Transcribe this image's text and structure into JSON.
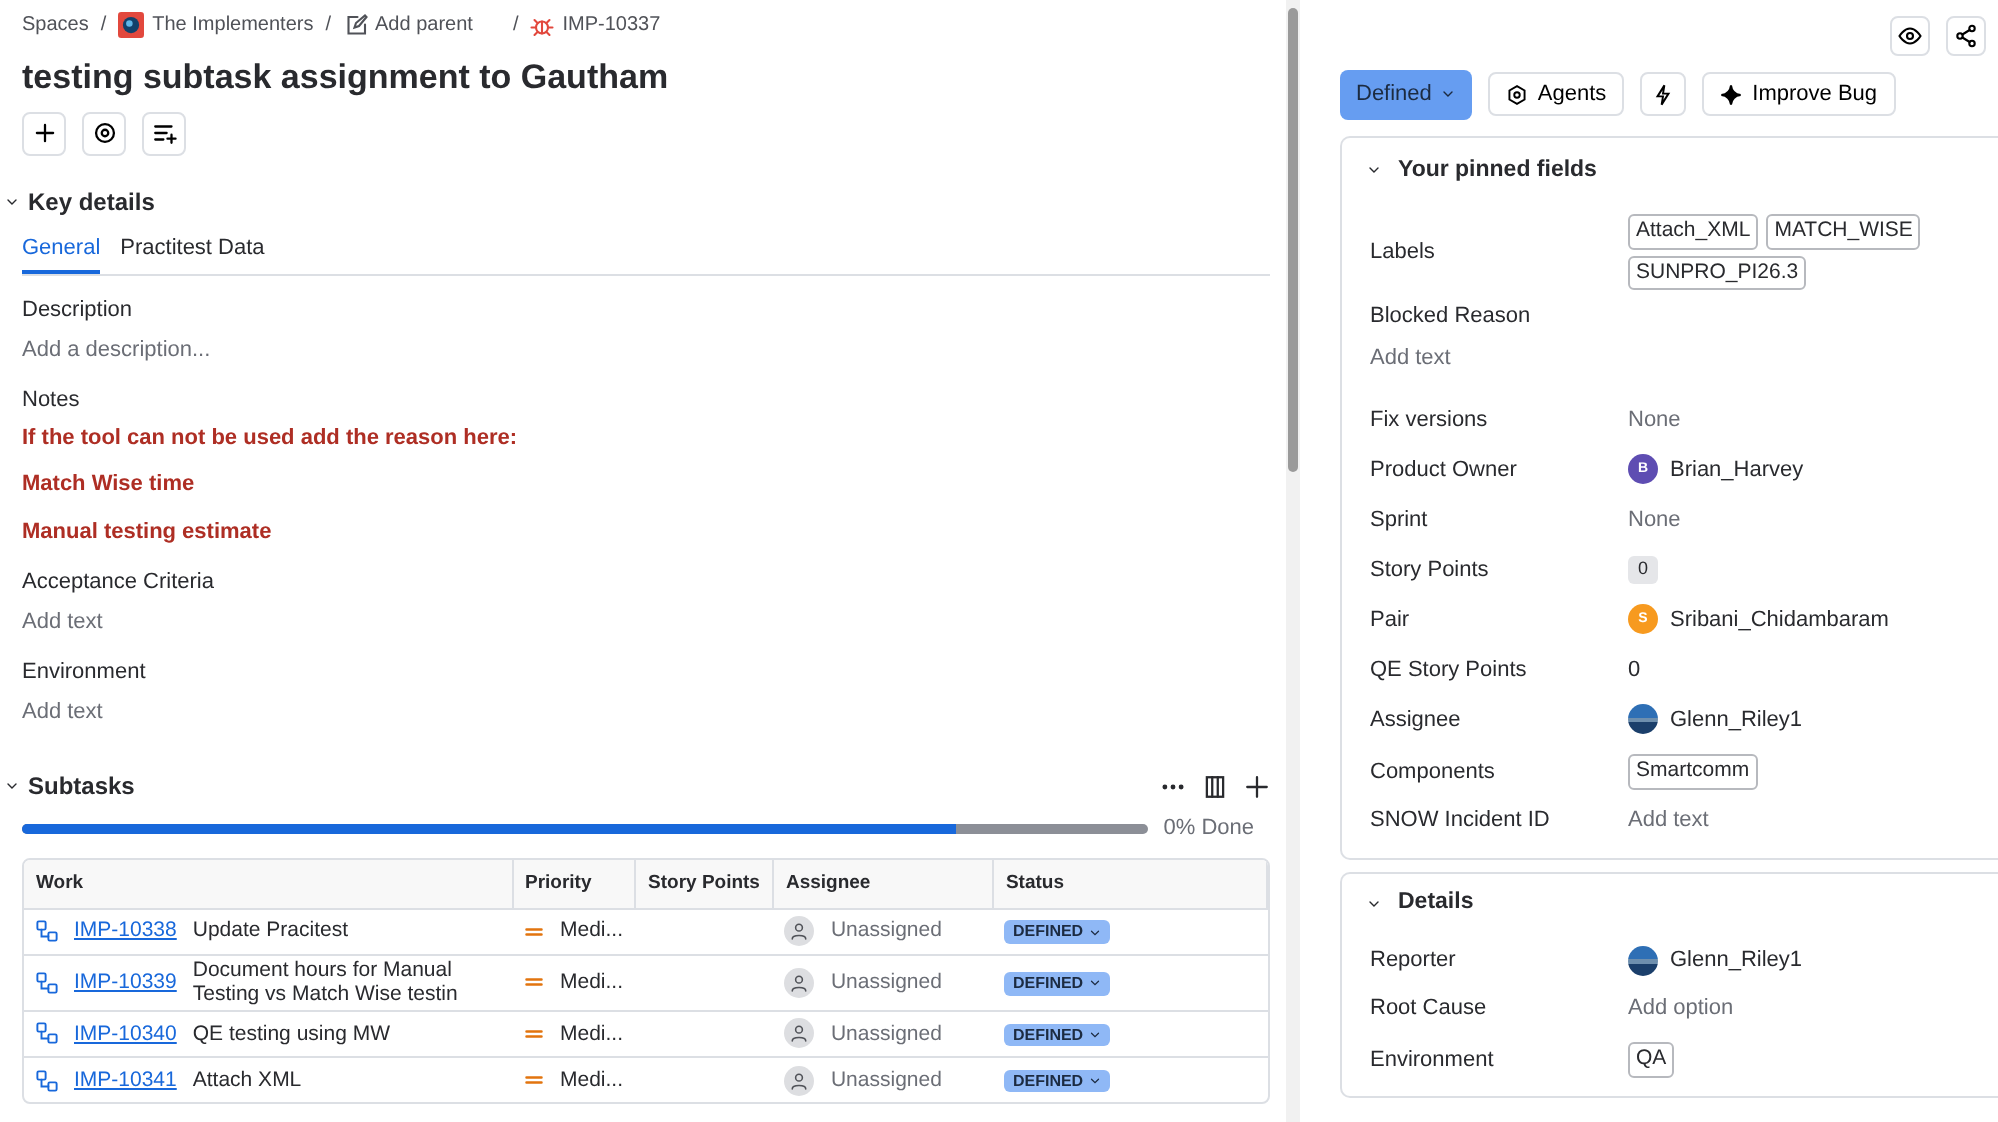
{
  "breadcrumbs": [
    {
      "label": "Spaces",
      "kind": "text",
      "separator": "/"
    },
    {
      "label": "The Implementers",
      "kind": "project",
      "separator": "/"
    },
    {
      "label": "Add parent",
      "kind": "parent",
      "separator": "/"
    },
    {
      "label": "IMP-10337",
      "kind": "bug"
    }
  ],
  "title": "testing subtask assignment to Gautham",
  "key_details": {
    "title": "Key details",
    "tabs": [
      {
        "label": "General",
        "selected": true
      },
      {
        "label": "Practitest Data",
        "selected": false
      }
    ],
    "fields": [
      {
        "label": "Description",
        "placeholder": "Add a description..."
      },
      {
        "label": "Notes",
        "notes": [
          "If the tool can not be used add the reason here:",
          "Match Wise time",
          "Manual testing estimate"
        ]
      },
      {
        "label": "Acceptance Criteria",
        "placeholder": "Add text"
      },
      {
        "label": "Environment",
        "placeholder": "Add text"
      }
    ]
  },
  "subtasks": {
    "title": "Subtasks",
    "level": 0.83,
    "progress_text": "0% Done",
    "columns": [
      "Work",
      "Priority",
      "Story Points",
      "Assignee",
      "Status"
    ],
    "rows": [
      {
        "key": "IMP-10338",
        "summary": "Update Pracitest",
        "priority": "Medi...",
        "assignee": "Unassigned",
        "status": "DEFINED"
      },
      {
        "key": "IMP-10339",
        "summary": "Document hours for Manual Testing vs Match Wise testin",
        "priority": "Medi...",
        "assignee": "Unassigned",
        "status": "DEFINED"
      },
      {
        "key": "IMP-10340",
        "summary": "QE testing using MW",
        "priority": "Medi...",
        "assignee": "Unassigned",
        "status": "DEFINED"
      },
      {
        "key": "IMP-10341",
        "summary": "Attach XML",
        "priority": "Medi...",
        "assignee": "Unassigned",
        "status": "DEFINED"
      }
    ]
  },
  "status_button": "Defined",
  "action_buttons": [
    {
      "label": "Agents",
      "kind": "agents"
    },
    {
      "kind": "lightning"
    },
    {
      "label": "Improve Bug",
      "kind": "sparkle"
    }
  ],
  "pinned": {
    "title": "Your pinned fields",
    "expanded": true,
    "fields": [
      {
        "label": "Labels",
        "kind": "tags",
        "tags": [
          "Attach_XML",
          "MATCH_WISE",
          "SUNPRO_PI26.3"
        ]
      },
      {
        "label": "Blocked Reason",
        "kind": "stacked",
        "value": "Add text"
      },
      {
        "label": "Fix versions",
        "kind": "muted",
        "value": "None"
      },
      {
        "label": "Product Owner",
        "kind": "user",
        "value": "Brian_Harvey",
        "initial": "B",
        "color": "#5e4db2"
      },
      {
        "label": "Sprint",
        "kind": "muted",
        "value": "None"
      },
      {
        "label": "Story Points",
        "kind": "count",
        "value": "0"
      },
      {
        "label": "Pair",
        "kind": "user",
        "value": "Sribani_Chidambaram",
        "initial": "S",
        "color": "#f79a1f"
      },
      {
        "label": "QE Story Points",
        "kind": "text",
        "value": "0"
      },
      {
        "label": "Assignee",
        "kind": "photo",
        "value": "Glenn_Riley1"
      },
      {
        "label": "Components",
        "kind": "tags",
        "tags": [
          "Smartcomm"
        ]
      },
      {
        "label": "SNOW Incident ID",
        "kind": "muted",
        "value": "Add text"
      }
    ]
  },
  "details": {
    "title": "Details",
    "expanded": true,
    "fields": [
      {
        "label": "Reporter",
        "kind": "photo",
        "value": "Glenn_Riley1"
      },
      {
        "label": "Root Cause",
        "kind": "muted",
        "value": "Add option"
      },
      {
        "label": "Environment",
        "kind": "tags",
        "tags": [
          "QA"
        ]
      }
    ]
  }
}
